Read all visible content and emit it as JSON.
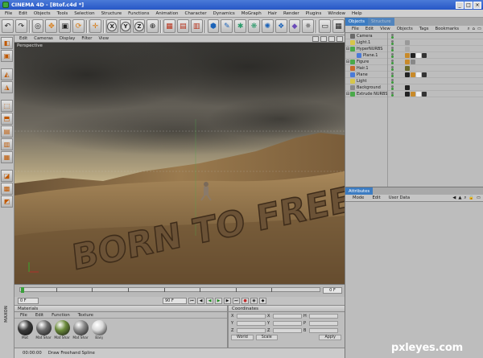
{
  "window": {
    "title": "CINEMA 4D - [Btof.c4d *]"
  },
  "menubar": [
    "File",
    "Edit",
    "Objects",
    "Tools",
    "Selection",
    "Structure",
    "Functions",
    "Animation",
    "Character",
    "Dynamics",
    "MoGraph",
    "Hair",
    "Render",
    "Plugins",
    "Window",
    "Help"
  ],
  "toolbar": {
    "axis_x": "X",
    "axis_y": "Y",
    "axis_z": "Z"
  },
  "viewport": {
    "menu": [
      "Edit",
      "Cameras",
      "Display",
      "Filter",
      "View"
    ],
    "label": "Perspective",
    "scene_text": "BORN TO FREE"
  },
  "timeline": {
    "end_frame": "0 F"
  },
  "playbar": {
    "start": "0 F",
    "current": "90 F"
  },
  "materials": {
    "title": "Materials",
    "menu": [
      "File",
      "Edit",
      "Function",
      "Texture"
    ],
    "items": [
      {
        "name": "Mat",
        "color": "#3a3a3a"
      },
      {
        "name": "Mat Shar",
        "color": "#6b6b6b"
      },
      {
        "name": "Mat Shar",
        "color": "#6a8a3a"
      },
      {
        "name": "Mat Shar",
        "color": "#8a8a8a"
      },
      {
        "name": "Banj",
        "color": "#d8d8d8"
      }
    ]
  },
  "coordinates": {
    "title": "Coordinates",
    "col1": [
      "X",
      "Y",
      "Z"
    ],
    "col2": [
      "X",
      "Y",
      "Z"
    ],
    "col3": [
      "H",
      "P",
      "B"
    ],
    "mode1": "World",
    "mode2": "Scale",
    "apply": "Apply"
  },
  "status": {
    "time": "00:00:00",
    "message": "Draw Freehand Spline"
  },
  "objects_panel": {
    "tabs": [
      "Objects",
      "Structure"
    ],
    "menu": [
      "File",
      "Edit",
      "View",
      "Objects",
      "Tags",
      "Bookmarks"
    ],
    "rows": [
      {
        "name": "Camera",
        "indent": 0,
        "color": "#6a6a6a"
      },
      {
        "name": "Light.1",
        "indent": 0,
        "color": "#d6c64a"
      },
      {
        "name": "HyperNURBS",
        "indent": 0,
        "color": "#4aa84a"
      },
      {
        "name": "Plane.1",
        "indent": 1,
        "color": "#4a7ad8"
      },
      {
        "name": "Figure",
        "indent": 0,
        "color": "#4aa84a"
      },
      {
        "name": "Hair.1",
        "indent": 0,
        "color": "#c86a2a"
      },
      {
        "name": "Plane",
        "indent": 0,
        "color": "#4a7ad8"
      },
      {
        "name": "Light",
        "indent": 0,
        "color": "#d6c64a"
      },
      {
        "name": "Background",
        "indent": 0,
        "color": "#8a8a8a"
      },
      {
        "name": "Extrude NURBS",
        "indent": 0,
        "color": "#4aa84a"
      }
    ]
  },
  "attributes_panel": {
    "title": "Attributes",
    "menu": [
      "Mode",
      "Edit",
      "User Data"
    ]
  },
  "branding": {
    "maxon": "MAXON",
    "watermark": "pxleyes.com"
  }
}
